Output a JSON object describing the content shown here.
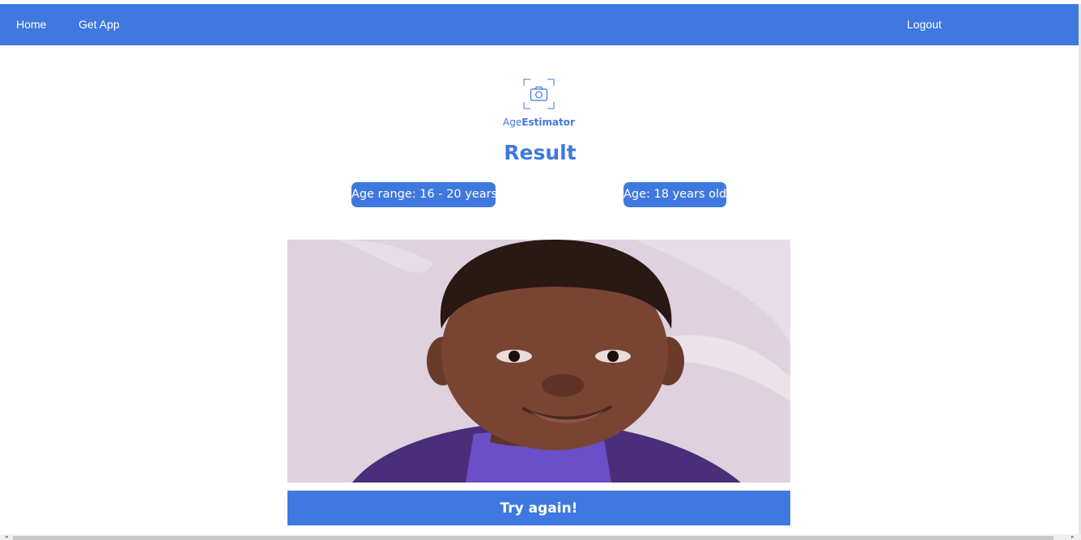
{
  "nav": {
    "home": "Home",
    "get_app": "Get App",
    "logout": "Logout"
  },
  "logo": {
    "icon": "camera-icon",
    "text_light": "Age",
    "text_bold": "Estimator"
  },
  "title": "Result",
  "results": {
    "age_range": "Age range: 16 - 20 years",
    "age": "Age: 18 years old"
  },
  "photo": {
    "subject": "portrait-photo"
  },
  "actions": {
    "try_again": "Try again!"
  },
  "colors": {
    "accent": "#3f78df",
    "background": "#ffffff",
    "text_on_accent": "#ffffff"
  }
}
